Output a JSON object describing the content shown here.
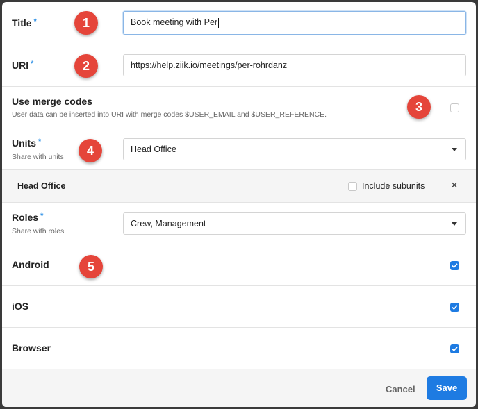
{
  "title_field": {
    "label": "Title",
    "required_mark": "*",
    "value": "Book meeting with Per"
  },
  "uri_field": {
    "label": "URI",
    "required_mark": "*",
    "value": "https://help.ziik.io/meetings/per-rohrdanz"
  },
  "merge_codes": {
    "label": "Use merge codes",
    "description": "User data can be inserted into URI with merge codes $USER_EMAIL and $USER_REFERENCE.",
    "checked": false
  },
  "units_field": {
    "label": "Units",
    "required_mark": "*",
    "sublabel": "Share with units",
    "selected": "Head Office"
  },
  "unit_entry": {
    "name": "Head Office",
    "include_subunits_label": "Include subunits",
    "include_subunits_checked": false,
    "remove_glyph": "×"
  },
  "roles_field": {
    "label": "Roles",
    "required_mark": "*",
    "sublabel": "Share with roles",
    "selected": "Crew, Management"
  },
  "platforms": [
    {
      "label": "Android",
      "checked": true
    },
    {
      "label": "iOS",
      "checked": true
    },
    {
      "label": "Browser",
      "checked": true
    }
  ],
  "badges": [
    "1",
    "2",
    "3",
    "4",
    "5"
  ],
  "footer": {
    "cancel_label": "Cancel",
    "save_label": "Save"
  },
  "colors": {
    "accent": "#1e7be2",
    "badge": "#e5453a",
    "required": "#2b8fe6"
  }
}
